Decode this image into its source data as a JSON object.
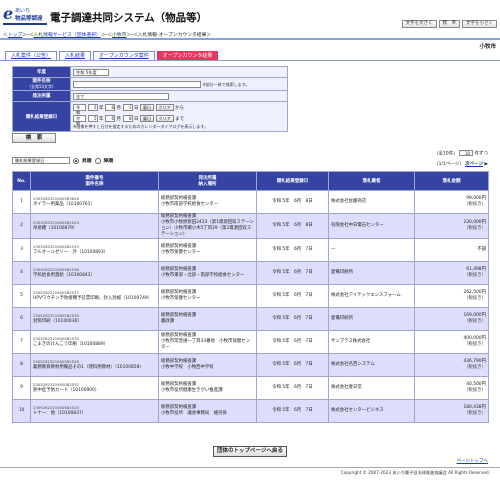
{
  "header": {
    "logo_e": "e",
    "logo_ai": "あいち",
    "logo_name": "物品等調達",
    "title": "電子調達共同システム（物品等）",
    "buttons": [
      "文字を大きく",
      "標　準",
      "文字を小さく"
    ]
  },
  "breadcrumb": {
    "top": "トップ",
    "info_service": "入札情報サービス（団体選択）",
    "city": "小牧市",
    "current": "入札情報-オープンカウンタ結果"
  },
  "organization": "小牧市",
  "tabs": [
    "入札案件（公告）",
    "入札結果",
    "オープンカウンタ案件",
    "オープンカウンタ結果"
  ],
  "search": {
    "year_label": "年度",
    "year_value": "令和 5年度",
    "case_name_label": "案件名称",
    "case_name_sub": "（全角50文字）",
    "case_name_note": "※部分一致で検索します。",
    "section_label": "発注所属",
    "section_value": "全て",
    "date_label": "開札結果登録日",
    "era1": "令和",
    "y1": "5",
    "m1": "6",
    "d1": "1",
    "era2": "令和",
    "y2": "5",
    "m2": "6",
    "d2": "8",
    "year_unit": "年",
    "month_unit": "月",
    "day_unit": "日",
    "calendar": "暦日",
    "clear": "クリア",
    "from": "から",
    "to": "まで",
    "date_note": "※画像を押すと日付を指定するためのカレンダーダイアログを表示します。",
    "button": "検　索"
  },
  "sort": {
    "select": "開札結果登録日",
    "asc": "昇順",
    "desc": "降順"
  },
  "pager": {
    "total": "（全10件）",
    "per_page": "10",
    "per_page_unit": "件ずつ",
    "page": "（1/1ページ）",
    "next": "次ページ"
  },
  "table": {
    "headers": {
      "no": "No.",
      "case": "案件番号\n案件名称",
      "dept": "発注所属\n納入場所",
      "date": "開札結果登録日",
      "winner": "落札業者",
      "amount": "落札金額"
    },
    "rows": [
      {
        "no": "1",
        "number": "230526232190058362​8",
        "name": "ボイラー用薬品（10100761）",
        "dept": "総務部契約検査課",
        "place": "小牧市南部学校給食センター",
        "date": "令和 5年　6月　8日",
        "winner": "株式会社佐藤商店",
        "amount": "99,000円",
        "tax": "（税抜き）"
      },
      {
        "no": "2",
        "number": "2305262321900582524",
        "name": "吊易糖（10100879）",
        "dept": "総務部契約検査課",
        "place": "小牧市小牧原新田2423（第1資源回収ステーション）小牧市郷小木5丁目29（第2資源回収ステーション）",
        "date": "令和 5年　6月　8日",
        "winner": "有限会社中日電石センター",
        "amount": "230,000円",
        "tax": "（税抜き）"
      },
      {
        "no": "3",
        "number": "2305262321900582533",
        "name": "フルオールゼリー　外（10100893）",
        "dept": "総務部契約検査課",
        "place": "小牧市保健センター",
        "date": "令和 5年　6月　7日",
        "winner": "—",
        "amount": "不調",
        "tax": ""
      },
      {
        "no": "4",
        "number": "2305262321900582536",
        "name": "学校給食用蓋給（10100843）",
        "dept": "総務部契約検査課",
        "place": "小牧市東部・北部・南部学校給食センター",
        "date": "令和 5年　6月　7日",
        "winner": "愛備印刷所",
        "amount": "61,498円",
        "tax": "（税抜き）"
      },
      {
        "no": "5",
        "number": "2305262321900582537",
        "name": "HPVワクチン予防接種予診票印刷、封入封緘（10100749）",
        "dept": "総務部契約検査課",
        "place": "小牧市保健センター",
        "date": "令和 5年　6月　7日",
        "winner": "株式会社アイテックエンスフォーム",
        "amount": "262,500円",
        "tax": "（税抜き）"
      },
      {
        "no": "6",
        "number": "2305262321900582535",
        "name": "封筒印刷（10100036）",
        "dept": "総務部契約検査課",
        "place": "農政課",
        "date": "令和 5年　6月　7日",
        "winner": "愛備印刷所",
        "amount": "169,000円",
        "tax": "（税抜き）"
      },
      {
        "no": "7",
        "number": "2305262321900582530",
        "name": "こまきのけんこう印刷（10100889）",
        "dept": "総務部契約検査課",
        "place": "小牧市常普請一丁目33番地　小牧市保健センター",
        "date": "令和 5年　6月　7日",
        "winner": "サンプラス株式会社",
        "amount": "400,000円",
        "tax": "（税抜き）"
      },
      {
        "no": "8",
        "number": "2305262321900582526",
        "name": "義務教育教材用備品その1（理科用教材）（10100858）",
        "dept": "総務部契約検査課",
        "place": "小牧中学校　小牧西中学校",
        "date": "令和 5年　6月　7日",
        "winner": "株式会社名西システム",
        "amount": "436,790円",
        "tax": "（税抜き）"
      },
      {
        "no": "9",
        "number": "2305262321900582532",
        "name": "熱中症予防カード（10100900）",
        "dept": "総務部契約検査課",
        "place": "小牧市役所健康生きがい推進課",
        "date": "令和 5年　6月　7日",
        "winner": "株式会社春日堂",
        "amount": "40,500円",
        "tax": "（税抜き）"
      },
      {
        "no": "10",
        "number": "2305262321900582525",
        "name": "トナー　他（10100837）",
        "dept": "総務部契約検査課",
        "place": "小牧市役所　議会事務局　維持係",
        "date": "令和 5年　6月　7日",
        "winner": "株式会社センタービジネス",
        "amount": "180,438円",
        "tax": "（税抜き）"
      }
    ]
  },
  "footer": {
    "top_button": "団体のトップページへ戻る",
    "page_top": "ページトップへ",
    "copyright": "Copyright © 2007-2023 あいち電子自治体推進協議会 All Rights Reserved."
  },
  "colors": {
    "accent": "#3543a3",
    "active_tab": "#e8365d",
    "row_alt": "#dedefc",
    "brand": "#1b3f9a"
  }
}
